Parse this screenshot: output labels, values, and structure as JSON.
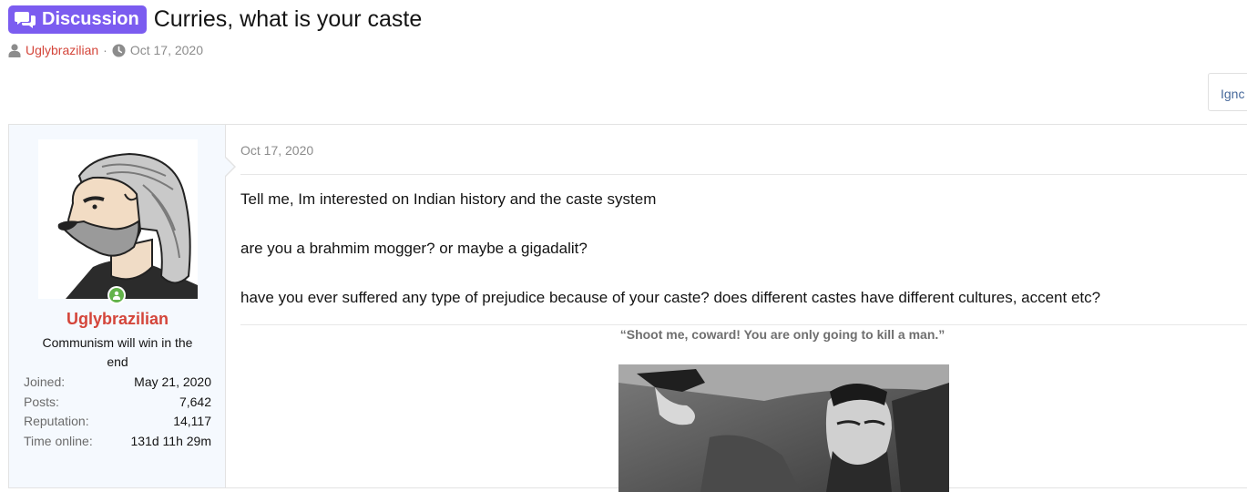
{
  "thread": {
    "prefix": "Discussion",
    "title": "Curries, what is your caste",
    "author": "Uglybrazilian",
    "separator": "·",
    "date": "Oct 17, 2020"
  },
  "ignore_button": "Ignc",
  "post": {
    "date": "Oct 17, 2020",
    "paragraphs": [
      "Tell me, Im interested on Indian history and the caste system",
      "are you a brahmim mogger? or maybe a gigadalit?",
      "have you ever suffered any type of prejudice because of your caste? does different castes have different cultures, accent etc?"
    ],
    "image_caption": "“Shoot me, coward! You are only going to kill a man.”"
  },
  "user": {
    "name": "Uglybrazilian",
    "title": "Communism will win in the end",
    "stats": [
      {
        "label": "Joined:",
        "value": "May 21, 2020"
      },
      {
        "label": "Posts:",
        "value": "7,642"
      },
      {
        "label": "Reputation:",
        "value": "14,117"
      },
      {
        "label": "Time online:",
        "value": "131d 11h 29m"
      }
    ]
  },
  "icons": {
    "prefix_icon": "comments-icon",
    "author_icon": "user-icon",
    "date_icon": "clock-icon",
    "online_icon": "online-user-icon"
  },
  "colors": {
    "prefix_bg": "#7b5cf0",
    "username": "#d4453a",
    "online": "#63b34a",
    "user_cell_bg": "#f5f9fe"
  }
}
